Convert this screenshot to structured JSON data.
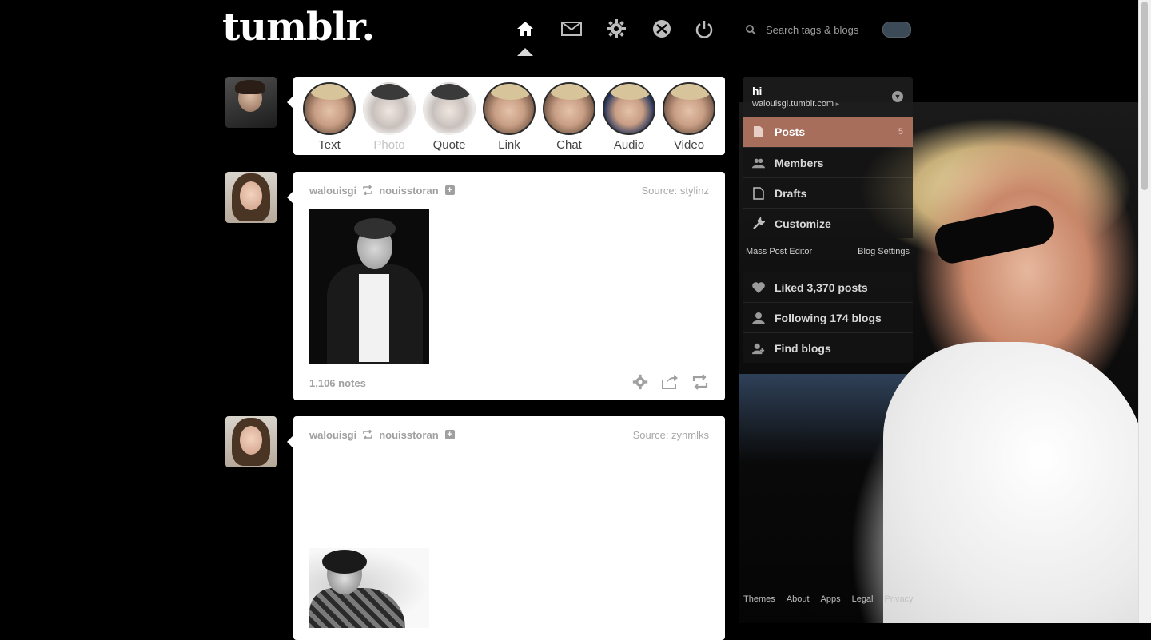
{
  "header": {
    "logo": "tumblr.",
    "search_placeholder": "Search tags & blogs"
  },
  "post_types": [
    {
      "label": "Text"
    },
    {
      "label": "Photo"
    },
    {
      "label": "Quote"
    },
    {
      "label": "Link"
    },
    {
      "label": "Chat"
    },
    {
      "label": "Audio"
    },
    {
      "label": "Video"
    }
  ],
  "posts": [
    {
      "user": "walouisgi",
      "reblogged_from": "nouisstoran",
      "source": "Source: stylinz",
      "notes": "1,106 notes"
    },
    {
      "user": "walouisgi",
      "reblogged_from": "nouisstoran",
      "source": "Source: zynmlks"
    }
  ],
  "sidebar": {
    "blog_name": "hi",
    "blog_url": "walouisgi.tumblr.com",
    "items": [
      {
        "label": "Posts",
        "count": "5"
      },
      {
        "label": "Members"
      },
      {
        "label": "Drafts"
      },
      {
        "label": "Customize"
      }
    ],
    "mass_post_editor": "Mass Post Editor",
    "blog_settings": "Blog Settings",
    "items2": [
      {
        "label": "Liked 3,370 posts"
      },
      {
        "label": "Following 174 blogs"
      },
      {
        "label": "Find blogs"
      }
    ]
  },
  "footer": [
    "Themes",
    "About",
    "Apps",
    "Legal",
    "Privacy"
  ],
  "colors": {
    "background": "#000000",
    "active_item": "#a86e5c",
    "post_bg": "#ffffff",
    "muted_text": "#a0a0a0"
  }
}
